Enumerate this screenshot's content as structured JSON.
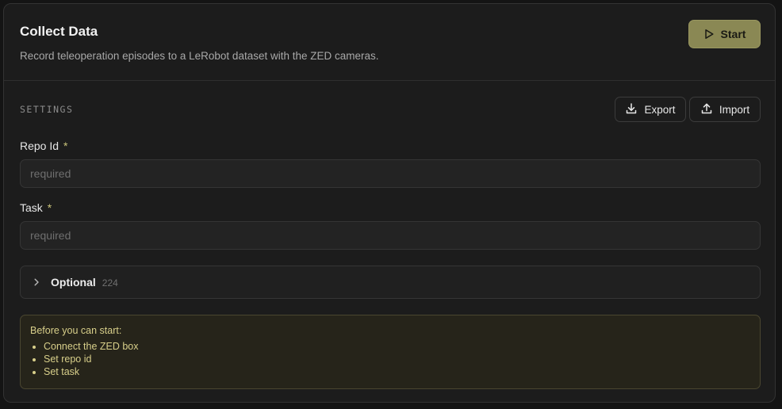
{
  "header": {
    "title": "Collect Data",
    "subtitle": "Record teleoperation episodes to a LeRobot dataset with the ZED cameras.",
    "start_label": "Start",
    "start_icon": "play-icon"
  },
  "settings": {
    "section_label": "SETTINGS",
    "export_label": "Export",
    "export_icon": "download-icon",
    "import_label": "Import",
    "import_icon": "upload-icon",
    "fields": [
      {
        "label": "Repo Id",
        "required_mark": "*",
        "value": "",
        "placeholder": "required"
      },
      {
        "label": "Task",
        "required_mark": "*",
        "value": "",
        "placeholder": "required"
      }
    ],
    "optional": {
      "label": "Optional",
      "count": "224",
      "expanded": false
    }
  },
  "notice": {
    "title": "Before you can start:",
    "items": [
      "Connect the ZED box",
      "Set repo id",
      "Set task"
    ]
  },
  "colors": {
    "accent": "#8a8854",
    "notice_text": "#d8cf8a",
    "background": "#1c1c1c"
  }
}
